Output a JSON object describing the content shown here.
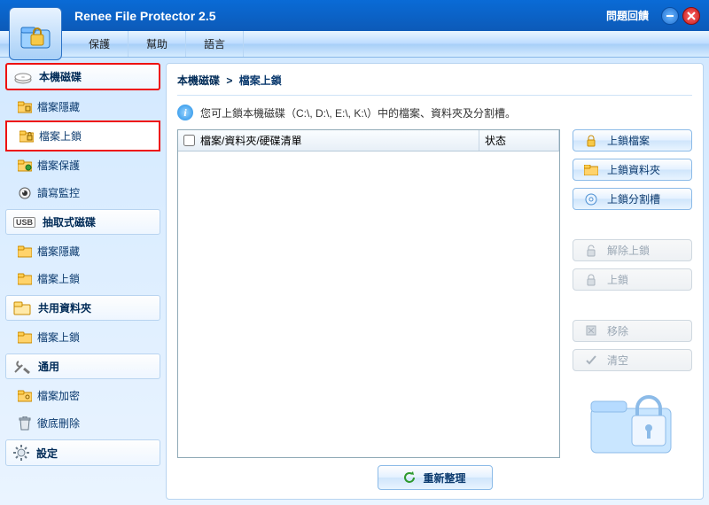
{
  "app": {
    "title": "Renee File Protector 2.5",
    "feedback_link": "問題回饋"
  },
  "menu": {
    "protect": "保護",
    "help": "幫助",
    "language": "語言"
  },
  "sidebar": {
    "local_disk": {
      "label": "本機磁碟",
      "items": [
        {
          "label": "檔案隱藏"
        },
        {
          "label": "檔案上鎖"
        },
        {
          "label": "檔案保護"
        },
        {
          "label": "讀寫監控"
        }
      ]
    },
    "removable": {
      "label": "抽取式磁碟",
      "items": [
        {
          "label": "檔案隱藏"
        },
        {
          "label": "檔案上鎖"
        }
      ]
    },
    "shared": {
      "label": "共用資料夾",
      "items": [
        {
          "label": "檔案上鎖"
        }
      ]
    },
    "general": {
      "label": "通用",
      "items": [
        {
          "label": "檔案加密"
        },
        {
          "label": "徹底刪除"
        }
      ]
    },
    "settings": {
      "label": "設定"
    }
  },
  "content": {
    "breadcrumb_root": "本機磁碟",
    "breadcrumb_sep": ">",
    "breadcrumb_leaf": "檔案上鎖",
    "info_text": "您可上鎖本機磁碟（C:\\, D:\\, E:\\, K:\\）中的檔案、資料夾及分割槽。",
    "table": {
      "col_items": "檔案/資料夾/硬碟清單",
      "col_status": "状态"
    },
    "actions": {
      "lock_file": "上鎖檔案",
      "lock_folder": "上鎖資料夾",
      "lock_partition": "上鎖分割槽",
      "unlock": "解除上鎖",
      "lock": "上鎖",
      "remove": "移除",
      "clear": "清空"
    },
    "refresh": "重新整理"
  },
  "colors": {
    "accent": "#0c5ab8",
    "highlight_border": "#e11212"
  }
}
